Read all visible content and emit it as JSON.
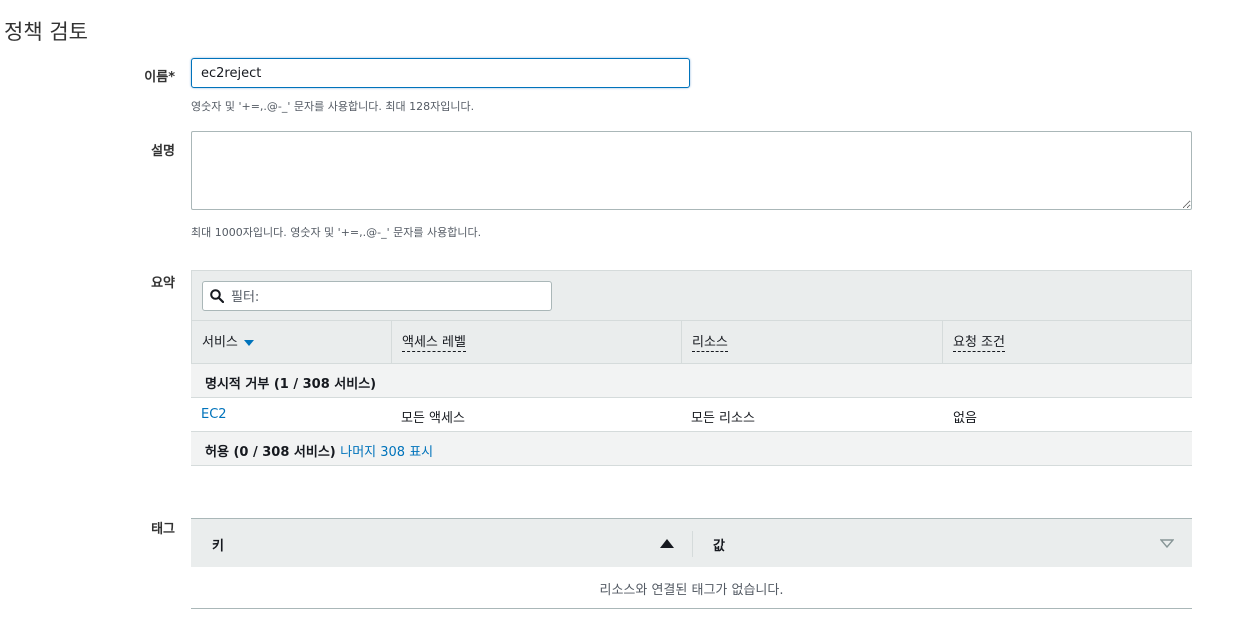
{
  "page": {
    "title": "정책 검토"
  },
  "name_field": {
    "label": "이름*",
    "value": "ec2reject",
    "hint": "영숫자 및 '+=,.@-_' 문자를 사용합니다. 최대 128자입니다."
  },
  "description_field": {
    "label": "설명",
    "value": "",
    "hint": "최대 1000자입니다. 영숫자 및 '+=,.@-_' 문자를 사용합니다."
  },
  "summary": {
    "label": "요약",
    "filter_placeholder": "필터:",
    "columns": [
      "서비스",
      "액세스 레벨",
      "리소스",
      "요청 조건"
    ],
    "deny_group": {
      "label": "명시적 거부 (1 / 308 서비스)"
    },
    "rows": [
      {
        "service": "EC2",
        "access_level": "모든 액세스",
        "resource": "모든 리소스",
        "condition": "없음"
      }
    ],
    "allow_group": {
      "label": "허용 (0 / 308 서비스)",
      "link": "나머지 308 표시"
    }
  },
  "tags": {
    "label": "태그",
    "columns": [
      "키",
      "값"
    ],
    "empty_message": "리소스와 연결된 태그가 없습니다."
  }
}
